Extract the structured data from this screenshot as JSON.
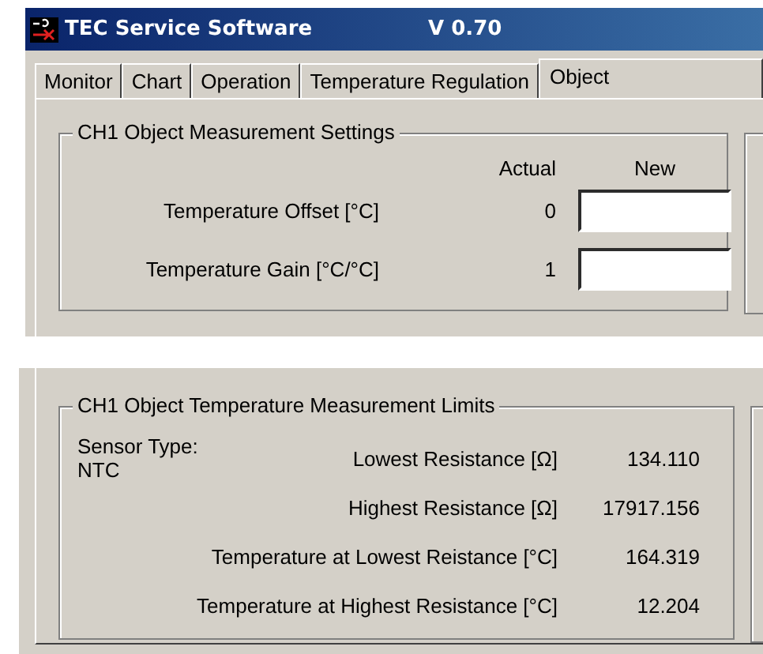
{
  "window": {
    "title": "TEC Service Software",
    "version": "V 0.70"
  },
  "tabs": [
    {
      "label": "Monitor",
      "selected": false
    },
    {
      "label": "Chart",
      "selected": false
    },
    {
      "label": "Operation",
      "selected": false
    },
    {
      "label": "Temperature Regulation",
      "selected": false
    },
    {
      "label": "Object",
      "selected": true
    }
  ],
  "measurement_settings": {
    "title": "CH1 Object Measurement Settings",
    "column_headers": [
      "Actual",
      "New"
    ],
    "rows": [
      {
        "label": "Temperature Offset [°C]",
        "actual": "0"
      },
      {
        "label": "Temperature Gain [°C/°C]",
        "actual": "1"
      }
    ]
  },
  "limits": {
    "title": "CH1 Object Temperature Measurement Limits",
    "sensor_type_label": "Sensor Type:",
    "sensor_type": "NTC",
    "rows": [
      {
        "label": "Lowest Resistance [Ω]",
        "value": "134.110"
      },
      {
        "label": "Highest Resistance [Ω]",
        "value": "17917.156"
      },
      {
        "label": "Temperature at Lowest Reistance [°C]",
        "value": "164.319"
      },
      {
        "label": "Temperature at Highest Resistance [°C]",
        "value": "12.204"
      }
    ]
  }
}
